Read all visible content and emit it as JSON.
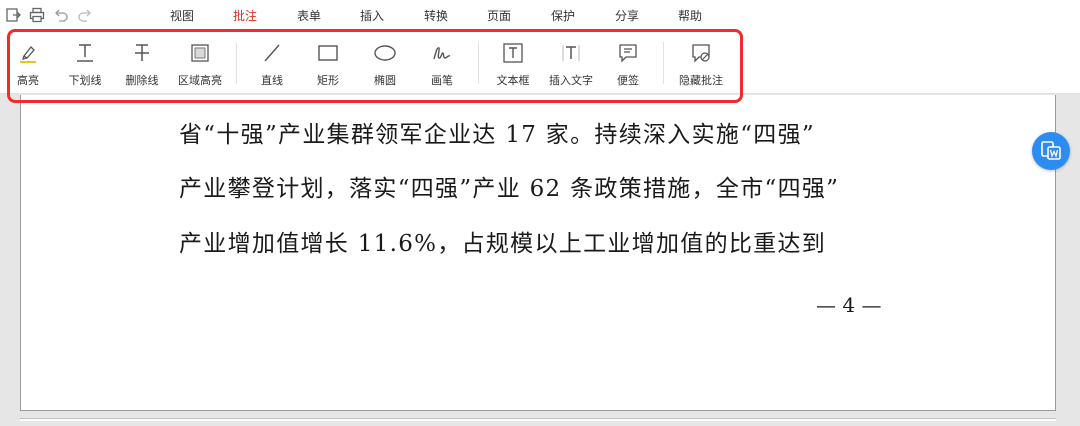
{
  "menu": {
    "items": [
      "视图",
      "批注",
      "表单",
      "插入",
      "转换",
      "页面",
      "保护",
      "分享",
      "帮助"
    ],
    "active": "批注"
  },
  "quick_icons": [
    "export-icon",
    "print-icon",
    "undo-icon",
    "redo-icon"
  ],
  "tools": {
    "highlight": "高亮",
    "underline": "下划线",
    "strikethrough": "删除线",
    "area_highlight": "区域高亮",
    "line": "直线",
    "rectangle": "矩形",
    "ellipse": "椭圆",
    "pen": "画笔",
    "textbox": "文本框",
    "insert_text": "插入文字",
    "sticky_note": "便签",
    "hide_annotations": "隐藏批注"
  },
  "colors": {
    "accent": "#d93025",
    "highlight_box": "#ef2b2b",
    "float_button": "#2d8cf0"
  },
  "document": {
    "lines": [
      "省“十强”产业集群领军企业达 17 家。持续深入实施“四强”",
      "产业攀登计划，落实“四强”产业 62 条政策措施，全市“四强”",
      "产业增加值增长 11.6%，占规模以上工业增加值的比重达到"
    ],
    "page_number": "— 4 —"
  }
}
